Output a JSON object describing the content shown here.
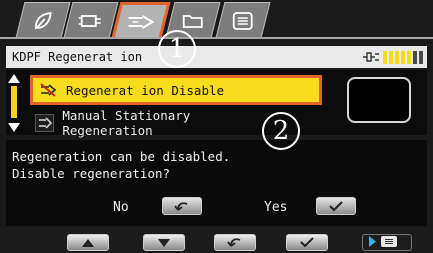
{
  "tabs": [
    {
      "icon": "leaf-icon",
      "active": false
    },
    {
      "icon": "engine-icon",
      "active": false
    },
    {
      "icon": "exhaust-regeneration-icon",
      "active": true
    },
    {
      "icon": "folder-icon",
      "active": false
    },
    {
      "icon": "menu-list-icon",
      "active": false
    }
  ],
  "header": {
    "title": "KDPF Regenerat ion",
    "status_icon": "plug-icon",
    "level_colors": [
      "#f4dd1c",
      "#f4dd1c",
      "#f4dd1c",
      "#f4dd1c",
      "#f4dd1c",
      "#4a4a4a",
      "#4a4a4a"
    ]
  },
  "menu": {
    "items": [
      {
        "icon": "regeneration-disable-icon",
        "label": "Regenerat ion Disable",
        "selected": true
      },
      {
        "icon": "manual-regeneration-icon",
        "label": "Manual Stationary Regeneration",
        "selected": false
      }
    ]
  },
  "message": {
    "line1": "Regeneration can be disabled.",
    "line2": "Disable regeneration?"
  },
  "choices": {
    "no_label": "No",
    "no_icon": "back-arrow-icon",
    "yes_label": "Yes",
    "yes_icon": "check-icon"
  },
  "softkeys": [
    "up-arrow-icon",
    "down-arrow-icon",
    "back-arrow-icon",
    "check-icon",
    "play-menu-icon"
  ],
  "callouts": {
    "one": "1",
    "two": "2"
  },
  "colors": {
    "accent": "#e3642b",
    "selection": "#f7dc1d"
  }
}
